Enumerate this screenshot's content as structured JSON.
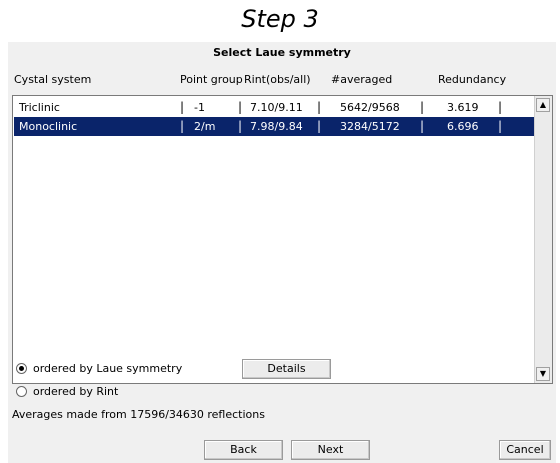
{
  "step_title": "Step 3",
  "dialog": {
    "title": "Select Laue symmetry",
    "columns": [
      "Cystal system",
      "Point group",
      "Rint(obs/all)",
      "#averaged",
      "Redundancy"
    ],
    "rows": [
      {
        "system": "Triclinic",
        "point_group": "-1",
        "rint": "7.10/9.11",
        "averaged": "5642/9568",
        "redundancy": "3.619",
        "selected": false
      },
      {
        "system": "Monoclinic",
        "point_group": "2/m",
        "rint": "7.98/9.84",
        "averaged": "3284/5172",
        "redundancy": "6.696",
        "selected": true
      }
    ],
    "separator": "|",
    "scroll_up_icon": "▲",
    "scroll_down_icon": "▼",
    "order_options": [
      {
        "label": "ordered by Laue symmetry",
        "selected": true
      },
      {
        "label": "ordered by Rint",
        "selected": false
      }
    ],
    "details_label": "Details",
    "status_text": "Averages made from 17596/34630 reflections",
    "back_label": "Back",
    "next_label": "Next",
    "cancel_label": "Cancel",
    "selection_color": "#0a246a"
  }
}
